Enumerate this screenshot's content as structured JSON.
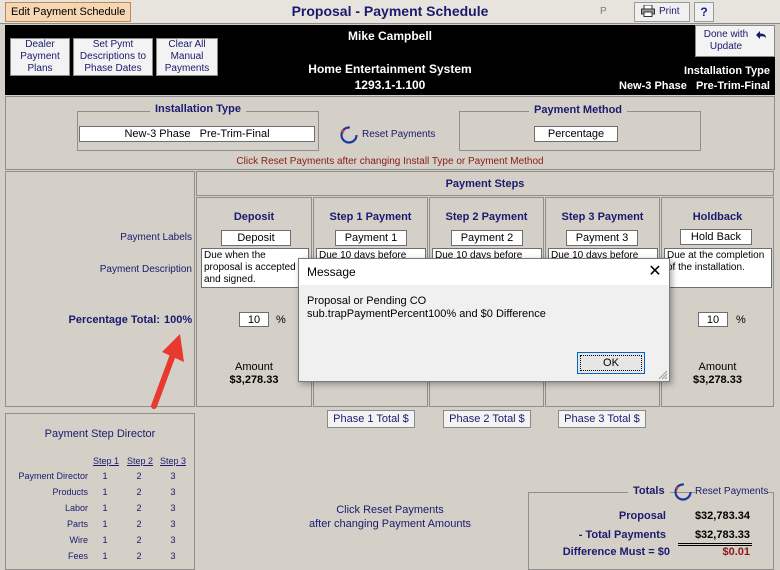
{
  "titlebar": {
    "tab_label": "Edit Payment Schedule",
    "title": "Proposal - Payment Schedule",
    "p_mark": "P",
    "print_label": "Print",
    "help_label": "?"
  },
  "header": {
    "btn_dealer": "Dealer Payment Plans",
    "btn_setpymt": "Set Pymt Descriptions to Phase Dates",
    "btn_clearall": "Clear All Manual Payments",
    "customer_name": "Mike Campbell",
    "project_name": "Home Entertainment System",
    "project_code": "1293.1-1.100",
    "done_label": "Done with Update",
    "install_type_label": "Installation Type",
    "install_type_value": "New-3 Phase   Pre-Trim-Final"
  },
  "install_panel": {
    "label": "Installation Type",
    "value": "New-3 Phase   Pre-Trim-Final",
    "reset_label": "Reset Payments"
  },
  "method_panel": {
    "label": "Payment Method",
    "value": "Percentage"
  },
  "reset_note": "Click Reset Payments after changing Install Type or Payment Method",
  "steps": {
    "heading": "Payment Steps",
    "row_labels_label": "Payment Labels",
    "row_desc_label": "Payment Description",
    "pct_total_label": "Percentage Total:",
    "pct_total_value": "100%",
    "columns": [
      {
        "header": "Deposit",
        "label": "Deposit",
        "desc": "Due when the proposal is accepted and signed.",
        "pct": "10",
        "amount_label": "Amount",
        "amount": "$3,278.33"
      },
      {
        "header": "Step 1 Payment",
        "label": "Payment 1",
        "desc": "Due 10 days before"
      },
      {
        "header": "Step 2 Payment",
        "label": "Payment 2",
        "desc": "Due 10 days before"
      },
      {
        "header": "Step 3 Payment",
        "label": "Payment 3",
        "desc": "Due 10 days before"
      },
      {
        "header": "Holdback",
        "label": "Hold Back",
        "desc": "Due at the completion of the installation.",
        "pct": "10",
        "amount_label": "Amount",
        "amount": "$3,278.33"
      }
    ],
    "pct_symbol": "%",
    "phase_buttons": [
      "Phase 1 Total $",
      "Phase 2 Total $",
      "Phase 3 Total $"
    ]
  },
  "director": {
    "title": "Payment Step Director",
    "headers": [
      "Step 1",
      "Step 2",
      "Step 3"
    ],
    "rows": [
      {
        "label": "Payment Director",
        "v": [
          "1",
          "2",
          "3"
        ]
      },
      {
        "label": "Products",
        "v": [
          "1",
          "2",
          "3"
        ]
      },
      {
        "label": "Labor",
        "v": [
          "1",
          "2",
          "3"
        ]
      },
      {
        "label": "Parts",
        "v": [
          "1",
          "2",
          "3"
        ]
      },
      {
        "label": "Wire",
        "v": [
          "1",
          "2",
          "3"
        ]
      },
      {
        "label": "Fees",
        "v": [
          "1",
          "2",
          "3"
        ]
      }
    ]
  },
  "middle_note": {
    "line1": "Click Reset Payments",
    "line2": "after changing Payment Amounts"
  },
  "totals": {
    "title": "Totals",
    "reset_label": "Reset Payments",
    "proposal_label": "Proposal",
    "proposal_value": "$32,783.34",
    "total_payments_label": "- Total Payments",
    "total_payments_value": "$32,783.33",
    "difference_label": "Difference Must = $0",
    "difference_value": "$0.01"
  },
  "dialog": {
    "title": "Message",
    "line1": "Proposal or Pending CO",
    "line2": "sub.trapPaymentPercent100% and $0 Difference",
    "ok_label": "OK",
    "close_glyph": "✕"
  },
  "colors": {
    "accent_red": "#e8392e",
    "navy_text": "#1a1a6e",
    "header_bg": "#000000",
    "tab_bg": "#f6d7b3"
  }
}
